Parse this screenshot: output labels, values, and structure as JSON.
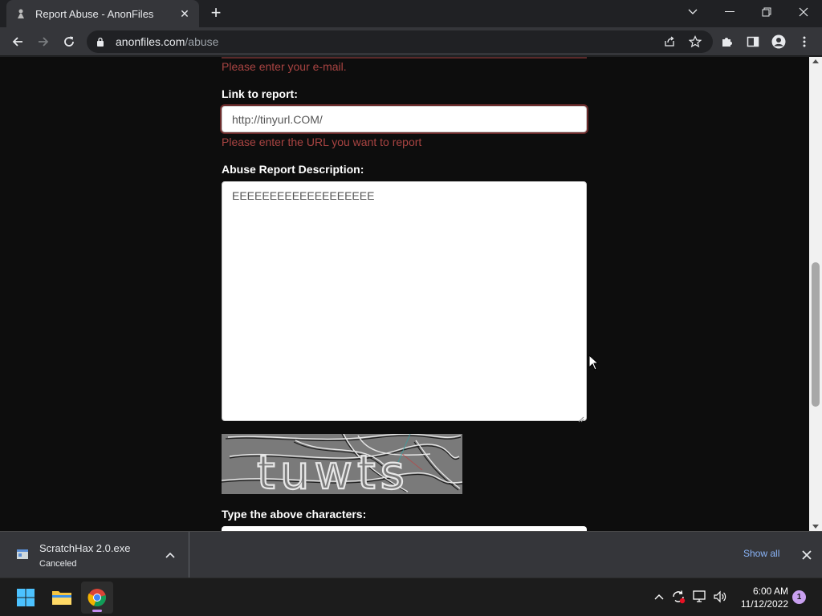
{
  "browser": {
    "tab_title": "Report Abuse - AnonFiles",
    "url_host": "anonfiles.com",
    "url_path": "/abuse"
  },
  "form": {
    "email_error": "Please enter your e-mail.",
    "link_label": "Link to report:",
    "link_value": "http://tinyurl.COM/",
    "link_error": "Please enter the URL you want to report",
    "description_label": "Abuse Report Description:",
    "description_value": "EEEEEEEEEEEEEEEEEEE",
    "captcha_text": "tuwts",
    "captcha_label": "Type the above characters:"
  },
  "downloads": {
    "file_name": "ScratchHax 2.0.exe",
    "status": "Canceled",
    "show_all": "Show all"
  },
  "taskbar": {
    "time": "6:00 AM",
    "date": "11/12/2022",
    "notification_count": "1"
  },
  "colors": {
    "error": "#a94442",
    "page_bg": "#0d0d0d",
    "link_blue": "#8ab4f8"
  }
}
